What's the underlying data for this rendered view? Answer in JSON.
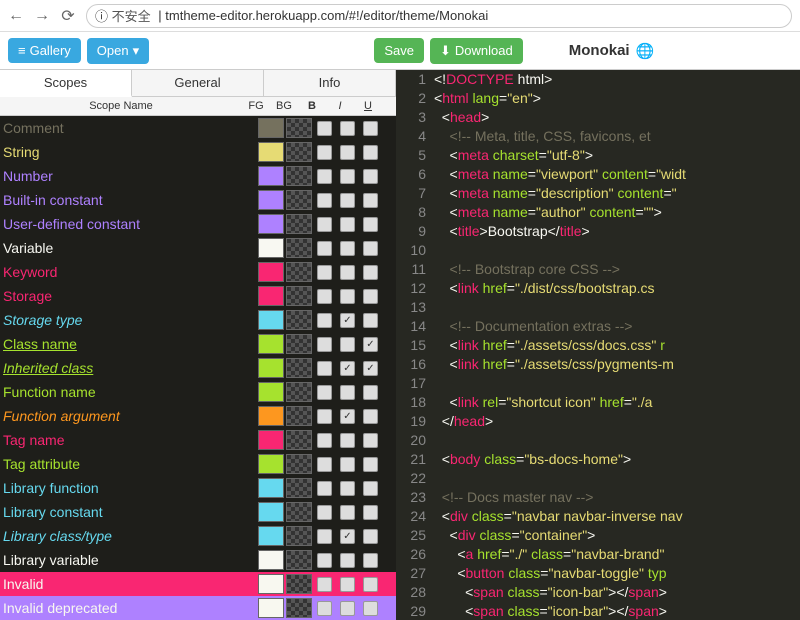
{
  "browser": {
    "insecure_label": "不安全",
    "url": "tmtheme-editor.herokuapp.com/#!/editor/theme/Monokai"
  },
  "toolbar": {
    "gallery": "Gallery",
    "open": "Open",
    "save": "Save",
    "download": "Download"
  },
  "tabs": [
    "Scopes",
    "General",
    "Info"
  ],
  "headers": {
    "name": "Scope Name",
    "fg": "FG",
    "bg": "BG",
    "b": "B",
    "i": "I",
    "u": "U"
  },
  "scopes": [
    {
      "name": "Comment",
      "fg": "#75715e",
      "bold": false,
      "italic": false,
      "underline": false,
      "bgRow": ""
    },
    {
      "name": "String",
      "fg": "#e6db74",
      "bold": false,
      "italic": false,
      "underline": false,
      "bgRow": ""
    },
    {
      "name": "Number",
      "fg": "#ae81ff",
      "bold": false,
      "italic": false,
      "underline": false,
      "bgRow": ""
    },
    {
      "name": "Built-in constant",
      "fg": "#ae81ff",
      "bold": false,
      "italic": false,
      "underline": false,
      "bgRow": ""
    },
    {
      "name": "User-defined constant",
      "fg": "#ae81ff",
      "bold": false,
      "italic": false,
      "underline": false,
      "bgRow": ""
    },
    {
      "name": "Variable",
      "fg": "#f8f8f2",
      "bold": false,
      "italic": false,
      "underline": false,
      "bgRow": ""
    },
    {
      "name": "Keyword",
      "fg": "#f92672",
      "bold": false,
      "italic": false,
      "underline": false,
      "bgRow": ""
    },
    {
      "name": "Storage",
      "fg": "#f92672",
      "bold": false,
      "italic": false,
      "underline": false,
      "bgRow": ""
    },
    {
      "name": "Storage type",
      "fg": "#66d9ef",
      "bold": false,
      "italic": true,
      "underline": false,
      "bgRow": ""
    },
    {
      "name": "Class name",
      "fg": "#a6e22e",
      "bold": false,
      "italic": false,
      "underline": true,
      "bgRow": ""
    },
    {
      "name": "Inherited class",
      "fg": "#a6e22e",
      "bold": false,
      "italic": true,
      "underline": true,
      "bgRow": ""
    },
    {
      "name": "Function name",
      "fg": "#a6e22e",
      "bold": false,
      "italic": false,
      "underline": false,
      "bgRow": ""
    },
    {
      "name": "Function argument",
      "fg": "#fd971f",
      "bold": false,
      "italic": true,
      "underline": false,
      "bgRow": ""
    },
    {
      "name": "Tag name",
      "fg": "#f92672",
      "bold": false,
      "italic": false,
      "underline": false,
      "bgRow": ""
    },
    {
      "name": "Tag attribute",
      "fg": "#a6e22e",
      "bold": false,
      "italic": false,
      "underline": false,
      "bgRow": ""
    },
    {
      "name": "Library function",
      "fg": "#66d9ef",
      "bold": false,
      "italic": false,
      "underline": false,
      "bgRow": ""
    },
    {
      "name": "Library constant",
      "fg": "#66d9ef",
      "bold": false,
      "italic": false,
      "underline": false,
      "bgRow": ""
    },
    {
      "name": "Library class/type",
      "fg": "#66d9ef",
      "bold": false,
      "italic": true,
      "underline": false,
      "bgRow": ""
    },
    {
      "name": "Library variable",
      "fg": "#f8f8f2",
      "bold": false,
      "italic": false,
      "underline": false,
      "bgRow": ""
    },
    {
      "name": "Invalid",
      "fg": "#f8f8f0",
      "bold": false,
      "italic": false,
      "underline": false,
      "bgRow": "#f92672"
    },
    {
      "name": "Invalid deprecated",
      "fg": "#f8f8f0",
      "bold": false,
      "italic": false,
      "underline": false,
      "bgRow": "#ae81ff"
    }
  ],
  "theme_name": "Monokai",
  "code_lines": [
    [
      {
        "c": "t-white",
        "t": "<!"
      },
      {
        "c": "t-pink",
        "t": "DOCTYPE"
      },
      {
        "c": "t-white",
        "t": " html>"
      }
    ],
    [
      {
        "c": "t-white",
        "t": "<"
      },
      {
        "c": "t-pink",
        "t": "html"
      },
      {
        "c": "t-white",
        "t": " "
      },
      {
        "c": "t-green",
        "t": "lang"
      },
      {
        "c": "t-white",
        "t": "="
      },
      {
        "c": "t-yellow",
        "t": "\"en\""
      },
      {
        "c": "t-white",
        "t": ">"
      }
    ],
    [
      {
        "c": "t-white",
        "t": "  <"
      },
      {
        "c": "t-pink",
        "t": "head"
      },
      {
        "c": "t-white",
        "t": ">"
      }
    ],
    [
      {
        "c": "t-comment",
        "t": "    <!-- Meta, title, CSS, favicons, et"
      }
    ],
    [
      {
        "c": "t-white",
        "t": "    <"
      },
      {
        "c": "t-pink",
        "t": "meta"
      },
      {
        "c": "t-white",
        "t": " "
      },
      {
        "c": "t-green",
        "t": "charset"
      },
      {
        "c": "t-white",
        "t": "="
      },
      {
        "c": "t-yellow",
        "t": "\"utf-8\""
      },
      {
        "c": "t-white",
        "t": ">"
      }
    ],
    [
      {
        "c": "t-white",
        "t": "    <"
      },
      {
        "c": "t-pink",
        "t": "meta"
      },
      {
        "c": "t-white",
        "t": " "
      },
      {
        "c": "t-green",
        "t": "name"
      },
      {
        "c": "t-white",
        "t": "="
      },
      {
        "c": "t-yellow",
        "t": "\"viewport\""
      },
      {
        "c": "t-white",
        "t": " "
      },
      {
        "c": "t-green",
        "t": "content"
      },
      {
        "c": "t-white",
        "t": "="
      },
      {
        "c": "t-yellow",
        "t": "\"widt"
      }
    ],
    [
      {
        "c": "t-white",
        "t": "    <"
      },
      {
        "c": "t-pink",
        "t": "meta"
      },
      {
        "c": "t-white",
        "t": " "
      },
      {
        "c": "t-green",
        "t": "name"
      },
      {
        "c": "t-white",
        "t": "="
      },
      {
        "c": "t-yellow",
        "t": "\"description\""
      },
      {
        "c": "t-white",
        "t": " "
      },
      {
        "c": "t-green",
        "t": "content"
      },
      {
        "c": "t-white",
        "t": "="
      },
      {
        "c": "t-yellow",
        "t": "\""
      }
    ],
    [
      {
        "c": "t-white",
        "t": "    <"
      },
      {
        "c": "t-pink",
        "t": "meta"
      },
      {
        "c": "t-white",
        "t": " "
      },
      {
        "c": "t-green",
        "t": "name"
      },
      {
        "c": "t-white",
        "t": "="
      },
      {
        "c": "t-yellow",
        "t": "\"author\""
      },
      {
        "c": "t-white",
        "t": " "
      },
      {
        "c": "t-green",
        "t": "content"
      },
      {
        "c": "t-white",
        "t": "="
      },
      {
        "c": "t-yellow",
        "t": "\"\""
      },
      {
        "c": "t-white",
        "t": ">"
      }
    ],
    [
      {
        "c": "t-white",
        "t": "    <"
      },
      {
        "c": "t-pink",
        "t": "title"
      },
      {
        "c": "t-white",
        "t": ">Bootstrap</"
      },
      {
        "c": "t-pink",
        "t": "title"
      },
      {
        "c": "t-white",
        "t": ">"
      }
    ],
    [],
    [
      {
        "c": "t-comment",
        "t": "    <!-- Bootstrap core CSS -->"
      }
    ],
    [
      {
        "c": "t-white",
        "t": "    <"
      },
      {
        "c": "t-pink",
        "t": "link"
      },
      {
        "c": "t-white",
        "t": " "
      },
      {
        "c": "t-green",
        "t": "href"
      },
      {
        "c": "t-white",
        "t": "="
      },
      {
        "c": "t-yellow",
        "t": "\"./dist/css/bootstrap.cs"
      }
    ],
    [],
    [
      {
        "c": "t-comment",
        "t": "    <!-- Documentation extras -->"
      }
    ],
    [
      {
        "c": "t-white",
        "t": "    <"
      },
      {
        "c": "t-pink",
        "t": "link"
      },
      {
        "c": "t-white",
        "t": " "
      },
      {
        "c": "t-green",
        "t": "href"
      },
      {
        "c": "t-white",
        "t": "="
      },
      {
        "c": "t-yellow",
        "t": "\"./assets/css/docs.css\""
      },
      {
        "c": "t-white",
        "t": " "
      },
      {
        "c": "t-green",
        "t": "r"
      }
    ],
    [
      {
        "c": "t-white",
        "t": "    <"
      },
      {
        "c": "t-pink",
        "t": "link"
      },
      {
        "c": "t-white",
        "t": " "
      },
      {
        "c": "t-green",
        "t": "href"
      },
      {
        "c": "t-white",
        "t": "="
      },
      {
        "c": "t-yellow",
        "t": "\"./assets/css/pygments-m"
      }
    ],
    [],
    [
      {
        "c": "t-white",
        "t": "    <"
      },
      {
        "c": "t-pink",
        "t": "link"
      },
      {
        "c": "t-white",
        "t": " "
      },
      {
        "c": "t-green",
        "t": "rel"
      },
      {
        "c": "t-white",
        "t": "="
      },
      {
        "c": "t-yellow",
        "t": "\"shortcut icon\""
      },
      {
        "c": "t-white",
        "t": " "
      },
      {
        "c": "t-green",
        "t": "href"
      },
      {
        "c": "t-white",
        "t": "="
      },
      {
        "c": "t-yellow",
        "t": "\"./a"
      }
    ],
    [
      {
        "c": "t-white",
        "t": "  </"
      },
      {
        "c": "t-pink",
        "t": "head"
      },
      {
        "c": "t-white",
        "t": ">"
      }
    ],
    [],
    [
      {
        "c": "t-white",
        "t": "  <"
      },
      {
        "c": "t-pink",
        "t": "body"
      },
      {
        "c": "t-white",
        "t": " "
      },
      {
        "c": "t-green",
        "t": "class"
      },
      {
        "c": "t-white",
        "t": "="
      },
      {
        "c": "t-yellow",
        "t": "\"bs-docs-home\""
      },
      {
        "c": "t-white",
        "t": ">"
      }
    ],
    [],
    [
      {
        "c": "t-comment",
        "t": "  <!-- Docs master nav -->"
      }
    ],
    [
      {
        "c": "t-white",
        "t": "  <"
      },
      {
        "c": "t-pink",
        "t": "div"
      },
      {
        "c": "t-white",
        "t": " "
      },
      {
        "c": "t-green",
        "t": "class"
      },
      {
        "c": "t-white",
        "t": "="
      },
      {
        "c": "t-yellow",
        "t": "\"navbar navbar-inverse nav"
      }
    ],
    [
      {
        "c": "t-white",
        "t": "    <"
      },
      {
        "c": "t-pink",
        "t": "div"
      },
      {
        "c": "t-white",
        "t": " "
      },
      {
        "c": "t-green",
        "t": "class"
      },
      {
        "c": "t-white",
        "t": "="
      },
      {
        "c": "t-yellow",
        "t": "\"container\""
      },
      {
        "c": "t-white",
        "t": ">"
      }
    ],
    [
      {
        "c": "t-white",
        "t": "      <"
      },
      {
        "c": "t-pink",
        "t": "a"
      },
      {
        "c": "t-white",
        "t": " "
      },
      {
        "c": "t-green",
        "t": "href"
      },
      {
        "c": "t-white",
        "t": "="
      },
      {
        "c": "t-yellow",
        "t": "\"./\""
      },
      {
        "c": "t-white",
        "t": " "
      },
      {
        "c": "t-green",
        "t": "class"
      },
      {
        "c": "t-white",
        "t": "="
      },
      {
        "c": "t-yellow",
        "t": "\"navbar-brand\""
      }
    ],
    [
      {
        "c": "t-white",
        "t": "      <"
      },
      {
        "c": "t-pink",
        "t": "button"
      },
      {
        "c": "t-white",
        "t": " "
      },
      {
        "c": "t-green",
        "t": "class"
      },
      {
        "c": "t-white",
        "t": "="
      },
      {
        "c": "t-yellow",
        "t": "\"navbar-toggle\""
      },
      {
        "c": "t-white",
        "t": " "
      },
      {
        "c": "t-green",
        "t": "typ"
      }
    ],
    [
      {
        "c": "t-white",
        "t": "        <"
      },
      {
        "c": "t-pink",
        "t": "span"
      },
      {
        "c": "t-white",
        "t": " "
      },
      {
        "c": "t-green",
        "t": "class"
      },
      {
        "c": "t-white",
        "t": "="
      },
      {
        "c": "t-yellow",
        "t": "\"icon-bar\""
      },
      {
        "c": "t-white",
        "t": "></"
      },
      {
        "c": "t-pink",
        "t": "span"
      },
      {
        "c": "t-white",
        "t": ">"
      }
    ],
    [
      {
        "c": "t-white",
        "t": "        <"
      },
      {
        "c": "t-pink",
        "t": "span"
      },
      {
        "c": "t-white",
        "t": " "
      },
      {
        "c": "t-green",
        "t": "class"
      },
      {
        "c": "t-white",
        "t": "="
      },
      {
        "c": "t-yellow",
        "t": "\"icon-bar\""
      },
      {
        "c": "t-white",
        "t": "></"
      },
      {
        "c": "t-pink",
        "t": "span"
      },
      {
        "c": "t-white",
        "t": ">"
      }
    ]
  ]
}
